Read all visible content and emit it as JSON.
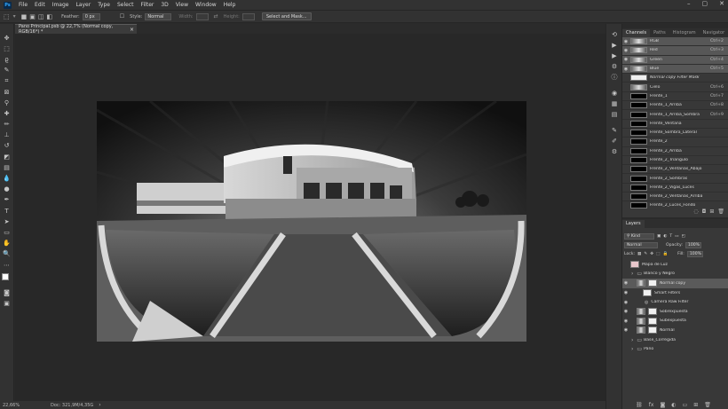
{
  "app": {
    "logo": "Ps"
  },
  "menu": [
    "File",
    "Edit",
    "Image",
    "Layer",
    "Type",
    "Select",
    "Filter",
    "3D",
    "View",
    "Window",
    "Help"
  ],
  "window_controls": [
    "minimize-icon",
    "maximize-icon",
    "close-icon"
  ],
  "options": {
    "feather_label": "Feather:",
    "feather_value": "0 px",
    "style_label": "Style:",
    "style_value": "Normal",
    "width_label": "Width:",
    "height_label": "Height:",
    "select_mask_label": "Select and Mask..."
  },
  "document": {
    "tab_title": "Pano Principal.psb @ 22,7% (Normal copy, RGB/16*) *",
    "zoom": "22,66%",
    "doc_info": "Doc: 321,9M/4,35G"
  },
  "channels_panel": {
    "tabs": [
      "Channels",
      "Paths",
      "Histogram",
      "Navigator"
    ],
    "active_tab": "Channels",
    "rows": [
      {
        "name": "RGB",
        "shortcut": "Ctrl+2",
        "thumb": "gray",
        "eye": true,
        "selected": true
      },
      {
        "name": "Red",
        "shortcut": "Ctrl+3",
        "thumb": "gray",
        "eye": true,
        "selected": true
      },
      {
        "name": "Green",
        "shortcut": "Ctrl+4",
        "thumb": "gray",
        "eye": true,
        "selected": true
      },
      {
        "name": "Blue",
        "shortcut": "Ctrl+5",
        "thumb": "gray",
        "eye": true,
        "selected": true
      },
      {
        "name": "Normal copy Filter Mask",
        "shortcut": "",
        "thumb": "white",
        "eye": false,
        "italic": true
      },
      {
        "name": "Cielo",
        "shortcut": "Ctrl+6",
        "thumb": "gray",
        "eye": false
      },
      {
        "name": "Frente_1",
        "shortcut": "Ctrl+7",
        "thumb": "black",
        "eye": false
      },
      {
        "name": "Frente_1_Arriba",
        "shortcut": "Ctrl+8",
        "thumb": "black",
        "eye": false
      },
      {
        "name": "Frente_1_Arriba_Sombra",
        "shortcut": "Ctrl+9",
        "thumb": "black",
        "eye": false
      },
      {
        "name": "Frente_Ventana",
        "shortcut": "",
        "thumb": "black",
        "eye": false
      },
      {
        "name": "Frente_Sombra_Lateral",
        "shortcut": "",
        "thumb": "black",
        "eye": false
      },
      {
        "name": "Frente_2",
        "shortcut": "",
        "thumb": "black",
        "eye": false
      },
      {
        "name": "Frente_2_Arriba",
        "shortcut": "",
        "thumb": "black",
        "eye": false
      },
      {
        "name": "Frente_2_Triangulo",
        "shortcut": "",
        "thumb": "black",
        "eye": false
      },
      {
        "name": "Frente_2_Ventanas_Abajo",
        "shortcut": "",
        "thumb": "black",
        "eye": false
      },
      {
        "name": "Frente_2_Sombras",
        "shortcut": "",
        "thumb": "black",
        "eye": false
      },
      {
        "name": "Frente_2_Vigas_Luces",
        "shortcut": "",
        "thumb": "black",
        "eye": false
      },
      {
        "name": "Frente_2_Ventanas_Arriba",
        "shortcut": "",
        "thumb": "black",
        "eye": false
      },
      {
        "name": "Frente_2_Luces_Fondo",
        "shortcut": "",
        "thumb": "black",
        "eye": false
      }
    ]
  },
  "layers_panel": {
    "title": "Layers",
    "kind_label": "Kind",
    "blend_mode": "Normal",
    "opacity_label": "Opacity:",
    "opacity_value": "100%",
    "lock_label": "Lock:",
    "fill_label": "Fill:",
    "fill_value": "100%",
    "layers": [
      {
        "name": "Mapa de Luz",
        "type": "layer",
        "thumb": "pink",
        "eye": false,
        "indent": 0
      },
      {
        "name": "Blanco y Negro",
        "type": "group",
        "eye": false,
        "indent": 0
      },
      {
        "name": "Normal copy",
        "type": "layer",
        "thumb": "gray",
        "eye": true,
        "indent": 1,
        "selected": true
      },
      {
        "name": "Smart Filters",
        "type": "filter",
        "thumb": "white",
        "eye": true,
        "indent": 2
      },
      {
        "name": "Camera Raw Filter",
        "type": "filter",
        "eye": true,
        "indent": 2
      },
      {
        "name": "Sobrexpuesta",
        "type": "layer",
        "thumb": "gray",
        "eye": true,
        "indent": 1
      },
      {
        "name": "Subexpuesta",
        "type": "layer",
        "thumb": "gray",
        "eye": true,
        "indent": 1
      },
      {
        "name": "Normal",
        "type": "layer",
        "thumb": "gray",
        "eye": true,
        "indent": 1
      },
      {
        "name": "Base_Corregida",
        "type": "group",
        "eye": false,
        "indent": 0
      },
      {
        "name": "Pano",
        "type": "group",
        "eye": false,
        "indent": 0
      }
    ]
  }
}
